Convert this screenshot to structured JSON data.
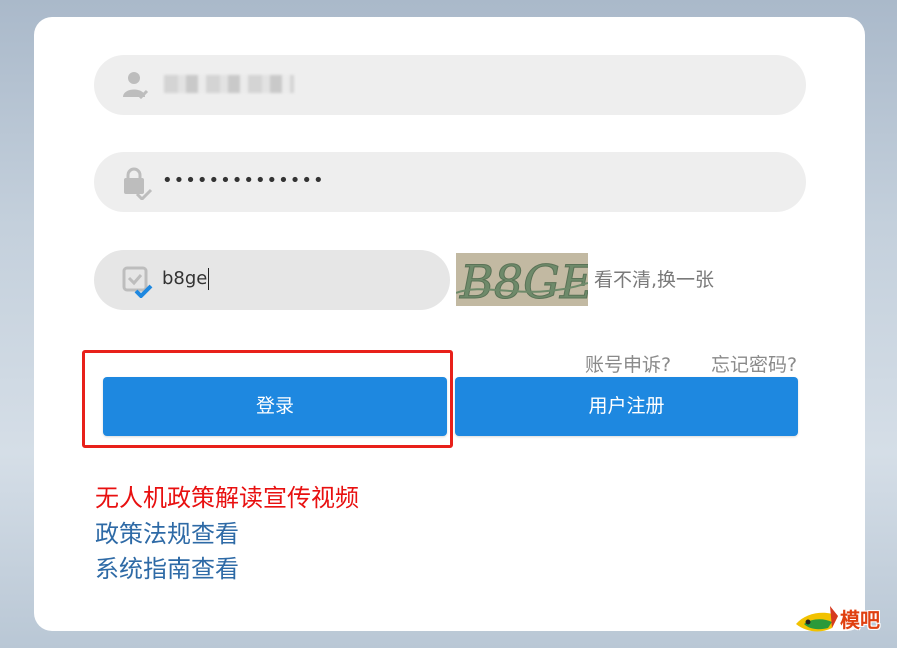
{
  "form": {
    "username": {
      "icon": "user-icon",
      "value": ""
    },
    "password": {
      "icon": "lock-icon",
      "value": "••••••••••••••"
    },
    "captcha": {
      "icon": "check-square-icon",
      "value": "b8ge"
    },
    "captcha_image_text": "B8GE",
    "refresh_label": "看不清,换一张"
  },
  "links": {
    "appeal": "账号申诉?",
    "forgot": "忘记密码?"
  },
  "buttons": {
    "login": "登录",
    "register": "用户注册"
  },
  "footer_links": {
    "policy_video": "无人机政策解读宣传视频",
    "policy_law": "政策法规查看",
    "system_guide": "系统指南查看"
  },
  "watermark": {
    "label": "模吧",
    "icon": "bird-logo-icon"
  },
  "colors": {
    "primary_button": "#1e88e0",
    "highlight_border": "#e8201a",
    "red_link": "#e81010",
    "blue_link": "#2e6aa6"
  }
}
